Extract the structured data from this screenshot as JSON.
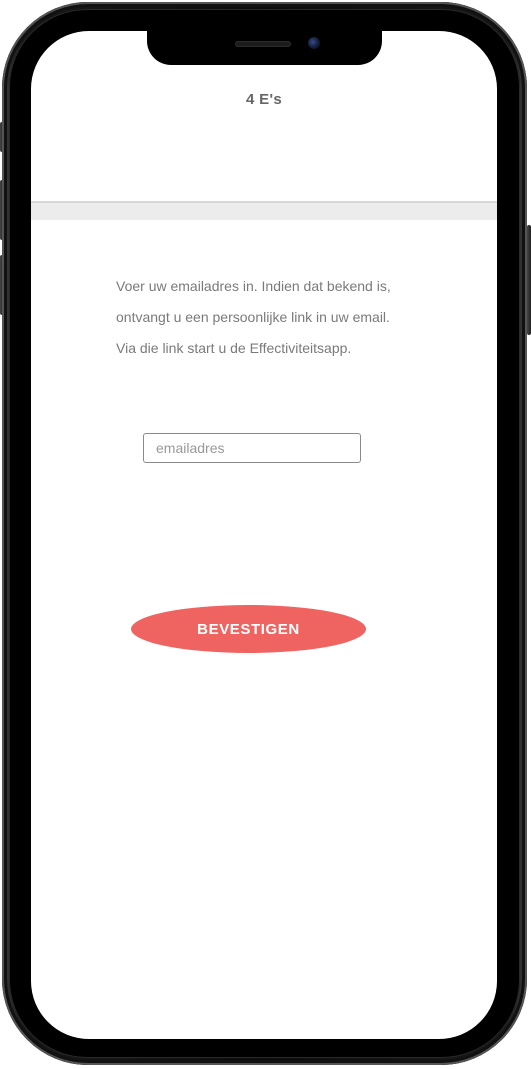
{
  "app": {
    "title": "4 E's"
  },
  "intro": {
    "line1": "Voer uw emailadres in. Indien dat bekend is,",
    "line2": "ontvangt u een persoonlijke link in uw email.",
    "line3": "Via die link start u de Effectiviteitsapp."
  },
  "email": {
    "value": "",
    "placeholder": "emailadres"
  },
  "confirm": {
    "label": "BEVESTIGEN"
  },
  "colors": {
    "accent": "#ef6461",
    "text_muted": "#7a7a7a",
    "title": "#666666"
  },
  "icons": {
    "camera": "front-camera-icon",
    "speaker": "speaker-grille-icon"
  }
}
